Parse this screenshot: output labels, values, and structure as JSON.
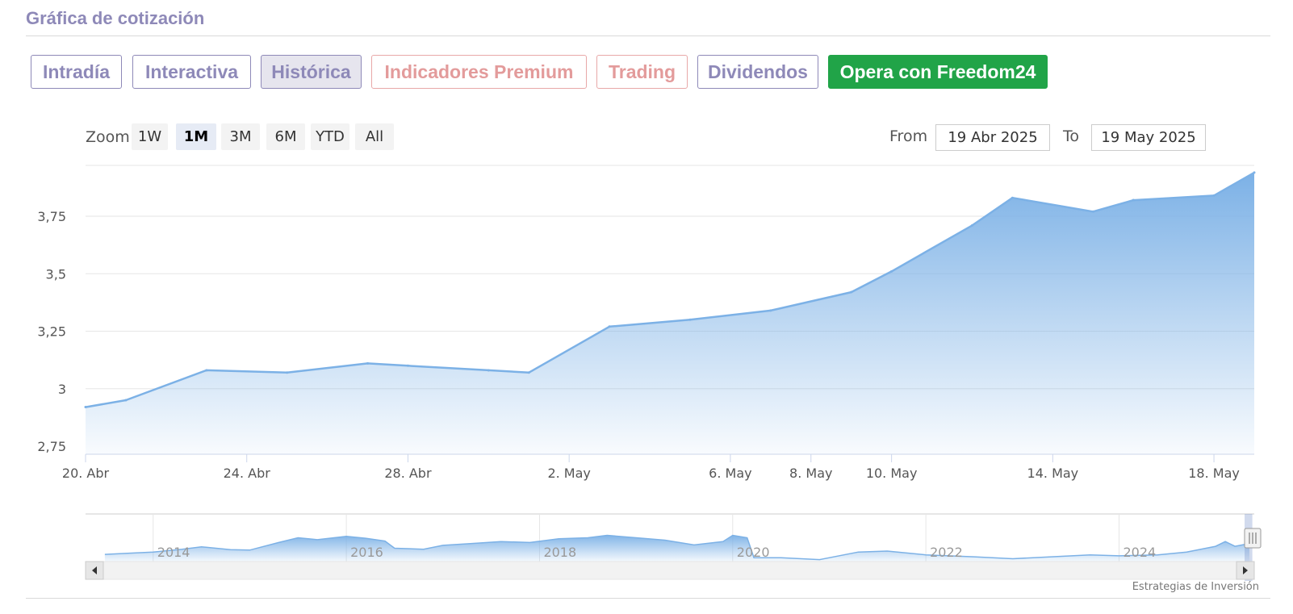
{
  "section_title": "Gráfica de cotización",
  "tabs": [
    {
      "label": "Intradía",
      "style": "normal"
    },
    {
      "label": "Interactiva",
      "style": "normal"
    },
    {
      "label": "Histórica",
      "style": "active"
    },
    {
      "label": "Indicadores Premium",
      "style": "red"
    },
    {
      "label": "Trading",
      "style": "red"
    },
    {
      "label": "Dividendos",
      "style": "normal"
    },
    {
      "label": "Opera con Freedom24",
      "style": "green"
    }
  ],
  "zoom": {
    "label": "Zoom",
    "buttons": [
      "1W",
      "1M",
      "3M",
      "6M",
      "YTD",
      "All"
    ],
    "selected": "1M"
  },
  "range": {
    "from_label": "From",
    "from_value": "19 Abr 2025",
    "to_label": "To",
    "to_value": "19 May 2025"
  },
  "credit": "Estrategias de Inversión",
  "colors": {
    "accent": "#8e89b8",
    "premium": "#e39b9b",
    "cta": "#21a448",
    "series_line": "#7cb1e6",
    "series_fill": "#9ec5ef"
  },
  "chart_data": {
    "type": "area",
    "xlabel": "",
    "ylabel": "",
    "ylim": [
      2.75,
      4.0
    ],
    "yticks": [
      {
        "value": 2.75,
        "label": "2,75"
      },
      {
        "value": 3.0,
        "label": "3"
      },
      {
        "value": 3.25,
        "label": "3,25"
      },
      {
        "value": 3.5,
        "label": "3,5"
      },
      {
        "value": 3.75,
        "label": "3,75"
      }
    ],
    "xlim": [
      "2025-04-20",
      "2025-05-19"
    ],
    "xticks": [
      {
        "date": "2025-04-20",
        "label": "20. Abr"
      },
      {
        "date": "2025-04-24",
        "label": "24. Abr"
      },
      {
        "date": "2025-04-28",
        "label": "28. Abr"
      },
      {
        "date": "2025-05-02",
        "label": "2. May"
      },
      {
        "date": "2025-05-06",
        "label": "6. May"
      },
      {
        "date": "2025-05-08",
        "label": "8. May"
      },
      {
        "date": "2025-05-10",
        "label": "10. May"
      },
      {
        "date": "2025-05-14",
        "label": "14. May"
      },
      {
        "date": "2025-05-18",
        "label": "18. May"
      }
    ],
    "grid": true,
    "series": [
      {
        "points": [
          {
            "date": "2025-04-20",
            "value": 2.92
          },
          {
            "date": "2025-04-21",
            "value": 2.95
          },
          {
            "date": "2025-04-23",
            "value": 3.08
          },
          {
            "date": "2025-04-25",
            "value": 3.07
          },
          {
            "date": "2025-04-27",
            "value": 3.11
          },
          {
            "date": "2025-04-28",
            "value": 3.1
          },
          {
            "date": "2025-04-30",
            "value": 3.08
          },
          {
            "date": "2025-05-01",
            "value": 3.07
          },
          {
            "date": "2025-05-03",
            "value": 3.27
          },
          {
            "date": "2025-05-05",
            "value": 3.3
          },
          {
            "date": "2025-05-07",
            "value": 3.34
          },
          {
            "date": "2025-05-09",
            "value": 3.42
          },
          {
            "date": "2025-05-10",
            "value": 3.51
          },
          {
            "date": "2025-05-12",
            "value": 3.71
          },
          {
            "date": "2025-05-13",
            "value": 3.83
          },
          {
            "date": "2025-05-15",
            "value": 3.77
          },
          {
            "date": "2025-05-16",
            "value": 3.82
          },
          {
            "date": "2025-05-18",
            "value": 3.84
          },
          {
            "date": "2025-05-19",
            "value": 3.94
          }
        ]
      }
    ],
    "navigator": {
      "xlim": [
        2013.3,
        2025.4
      ],
      "year_labels": [
        {
          "year": 2014,
          "label": "2014"
        },
        {
          "year": 2016,
          "label": "2016"
        },
        {
          "year": 2018,
          "label": "2018"
        },
        {
          "year": 2020,
          "label": "2020"
        },
        {
          "year": 2022,
          "label": "2022"
        },
        {
          "year": 2024,
          "label": "2024"
        }
      ],
      "selected_range": [
        2025.3,
        2025.38
      ],
      "series": [
        {
          "t": 2013.5,
          "v": 0.15
        },
        {
          "t": 2013.8,
          "v": 0.18
        },
        {
          "t": 2014.0,
          "v": 0.2
        },
        {
          "t": 2014.3,
          "v": 0.26
        },
        {
          "t": 2014.5,
          "v": 0.31
        },
        {
          "t": 2014.8,
          "v": 0.25
        },
        {
          "t": 2015.0,
          "v": 0.24
        },
        {
          "t": 2015.3,
          "v": 0.4
        },
        {
          "t": 2015.5,
          "v": 0.5
        },
        {
          "t": 2015.7,
          "v": 0.46
        },
        {
          "t": 2016.0,
          "v": 0.53
        },
        {
          "t": 2016.2,
          "v": 0.49
        },
        {
          "t": 2016.4,
          "v": 0.43
        },
        {
          "t": 2016.5,
          "v": 0.28
        },
        {
          "t": 2016.8,
          "v": 0.26
        },
        {
          "t": 2017.0,
          "v": 0.34
        },
        {
          "t": 2017.3,
          "v": 0.38
        },
        {
          "t": 2017.6,
          "v": 0.42
        },
        {
          "t": 2017.9,
          "v": 0.4
        },
        {
          "t": 2018.2,
          "v": 0.48
        },
        {
          "t": 2018.5,
          "v": 0.5
        },
        {
          "t": 2018.7,
          "v": 0.55
        },
        {
          "t": 2019.0,
          "v": 0.5
        },
        {
          "t": 2019.3,
          "v": 0.45
        },
        {
          "t": 2019.6,
          "v": 0.35
        },
        {
          "t": 2019.9,
          "v": 0.42
        },
        {
          "t": 2020.0,
          "v": 0.55
        },
        {
          "t": 2020.15,
          "v": 0.5
        },
        {
          "t": 2020.22,
          "v": 0.08
        },
        {
          "t": 2020.5,
          "v": 0.08
        },
        {
          "t": 2020.9,
          "v": 0.04
        },
        {
          "t": 2021.3,
          "v": 0.2
        },
        {
          "t": 2021.6,
          "v": 0.22
        },
        {
          "t": 2022.0,
          "v": 0.14
        },
        {
          "t": 2022.5,
          "v": 0.1
        },
        {
          "t": 2022.9,
          "v": 0.06
        },
        {
          "t": 2023.3,
          "v": 0.1
        },
        {
          "t": 2023.7,
          "v": 0.14
        },
        {
          "t": 2024.0,
          "v": 0.12
        },
        {
          "t": 2024.4,
          "v": 0.14
        },
        {
          "t": 2024.7,
          "v": 0.2
        },
        {
          "t": 2025.0,
          "v": 0.32
        },
        {
          "t": 2025.1,
          "v": 0.42
        },
        {
          "t": 2025.2,
          "v": 0.32
        },
        {
          "t": 2025.35,
          "v": 0.38
        }
      ]
    }
  }
}
